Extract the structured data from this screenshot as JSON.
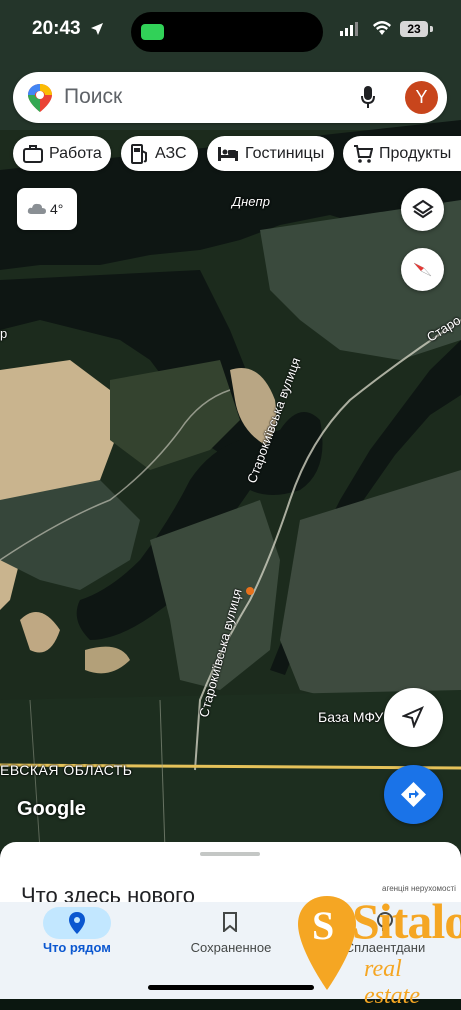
{
  "status_bar": {
    "time": "20:43",
    "battery": "23"
  },
  "search": {
    "placeholder": "Поиск",
    "avatar_letter": "Y"
  },
  "chips": [
    {
      "label": "Работа",
      "icon": "briefcase-icon"
    },
    {
      "label": "АЗС",
      "icon": "fuel-icon"
    },
    {
      "label": "Гостиницы",
      "icon": "bed-icon"
    },
    {
      "label": "Продукты",
      "icon": "cart-icon"
    }
  ],
  "weather": {
    "temp": "4°",
    "icon": "cloud-icon"
  },
  "map": {
    "labels": {
      "river": "Днепр",
      "street_1": "Старокиївська вулиця",
      "street_2": "Старокиївська вулиця",
      "street_3": "Старо",
      "place": "База МФУ",
      "region": "ЕВСКАЯ ОБЛАСТЬ",
      "edge_fragment": "р"
    },
    "attribution": "Google"
  },
  "sheet": {
    "title": "Что здесь нового"
  },
  "nav": {
    "items": [
      {
        "label": "Что рядом",
        "icon": "location-pin-icon",
        "active": true
      },
      {
        "label": "Сохраненное",
        "icon": "bookmark-icon",
        "active": false
      },
      {
        "label": "Сплаентдани",
        "icon": "lightbulb-icon",
        "active": false
      }
    ]
  },
  "watermark": {
    "brand": "Sitalo",
    "tagline": "real estate",
    "small_text": "агенція нерухомості"
  },
  "colors": {
    "accent": "#1a73e8",
    "avatar": "#c8451c",
    "nav_active": "#c2e7ff",
    "watermark": "#f5a623"
  }
}
